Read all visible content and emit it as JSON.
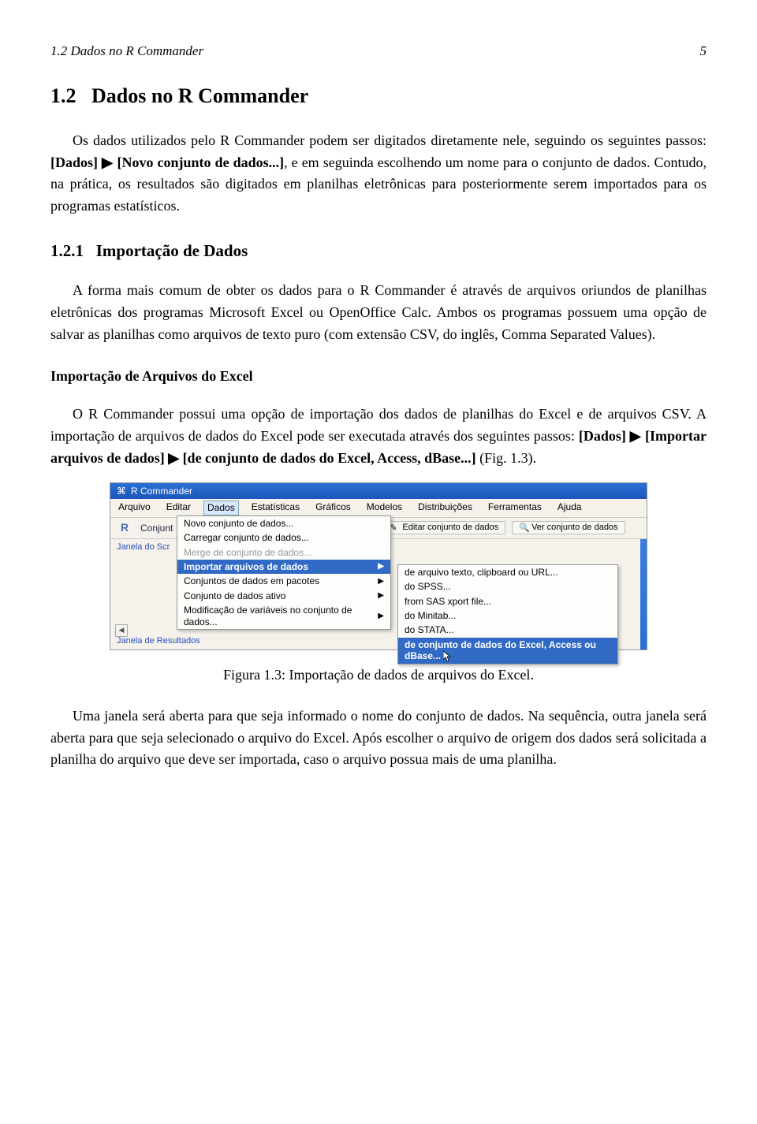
{
  "header": {
    "section_ref": "1.2 Dados no R Commander",
    "page_number": "5"
  },
  "section": {
    "number": "1.2",
    "title": "Dados no R Commander"
  },
  "para1_a": "Os dados utilizados pelo R Commander podem ser digitados diretamente nele, seguindo os seguintes passos: ",
  "para1_bold1": "[Dados] ",
  "tri": "▶",
  "para1_bold2": " [Novo conjunto de dados...]",
  "para1_b": ", e em seguinda escolhendo um nome para o conjunto de dados. Contudo, na prática, os resultados são digitados em planilhas eletrônicas para posteriormente serem importados para os programas estatísticos.",
  "subsection": {
    "number": "1.2.1",
    "title": "Importação de Dados"
  },
  "para2": "A forma mais comum de obter os dados para o R Commander é através de arquivos oriundos de planilhas eletrônicas dos programas Microsoft Excel ou OpenOffice Calc. Ambos os programas possuem uma opção de salvar as planilhas como arquivos de texto puro (com extensão CSV, do inglês, Comma Separated Values).",
  "subsub": "Importação de Arquivos do Excel",
  "para3_a": "O R Commander possui uma opção de importação dos dados de planilhas do Excel e de arquivos CSV. A importação de arquivos de dados do Excel pode ser executada através dos seguintes passos: ",
  "para3_bold1": "[Dados] ",
  "para3_bold2": " [Importar arquivos de dados] ",
  "para3_bold3": " [de conjunto de dados do Excel, Access, dBase...]",
  "para3_b": " (Fig. 1.3).",
  "figure": {
    "title": "R Commander",
    "menubar": [
      "Arquivo",
      "Editar",
      "Dados",
      "Estatísticas",
      "Gráficos",
      "Modelos",
      "Distribuições",
      "Ferramentas",
      "Ajuda"
    ],
    "toolbar_label": "Conjunt",
    "btn_edit": "Editar conjunto de dados",
    "btn_view": "Ver conjunto de dados",
    "script_label": "Janela do Scr",
    "dropdown": {
      "novo": "Novo conjunto de dados...",
      "carregar": "Carregar conjunto de dados...",
      "merge": "Merge de conjunto de dados...",
      "importar": "Importar arquivos de dados",
      "pacotes": "Conjuntos de dados em pacotes",
      "ativo": "Conjunto de dados ativo",
      "modvar": "Modificação de variáveis no conjunto de dados..."
    },
    "submenu": {
      "texto": "de arquivo texto, clipboard ou URL...",
      "spss": "do SPSS...",
      "sas": "from SAS xport file...",
      "minitab": "do Minitab...",
      "stata": "do STATA...",
      "excel": "de conjunto de dados do Excel, Access ou dBase..."
    },
    "result_label": "Janela de Resultados",
    "caption": "Figura 1.3: Importação de dados de arquivos do Excel."
  },
  "para4": "Uma janela será aberta para que seja informado o nome do conjunto de dados. Na sequência, outra janela será aberta para que seja selecionado o arquivo do Excel. Após escolher o arquivo de origem dos dados será solicitada a planilha do arquivo que deve ser importada, caso o arquivo possua mais de uma planilha."
}
